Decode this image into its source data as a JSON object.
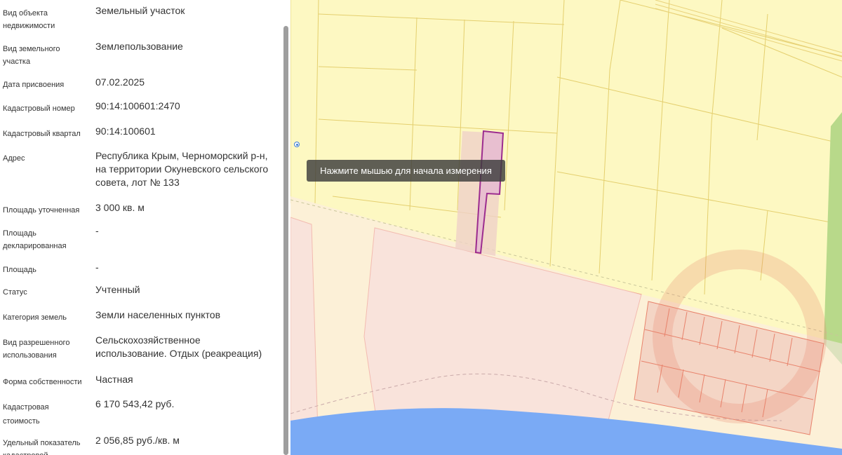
{
  "properties": [
    {
      "label": "Вид объекта\nнедвижимости",
      "value": "Земельный участок"
    },
    {
      "label": "Вид земельного\nучастка",
      "value": "Землепользование"
    },
    {
      "label": "Дата присвоения",
      "value": "07.02.2025"
    },
    {
      "label": "Кадастровый номер",
      "value": "90:14:100601:2470"
    },
    {
      "label": "Кадастровый квартал",
      "value": "90:14:100601"
    },
    {
      "label": "Адрес",
      "value": "Республика Крым, Черноморский р-н, на территории Окуневского сельского совета, лот № 133"
    },
    {
      "label": "Площадь уточненная",
      "value": "3 000 кв. м"
    },
    {
      "label": "Площадь\nдекларированная",
      "value": "-"
    },
    {
      "label": "Площадь",
      "value": "-"
    },
    {
      "label": "Статус",
      "value": "Учтенный"
    },
    {
      "label": "Категория земель",
      "value": "Земли населенных пунктов"
    },
    {
      "label": "Вид разрешенного\nиспользования",
      "value": "Сельскохозяйственное использование. Отдых (реакреация)"
    },
    {
      "label": "Форма собственности",
      "value": "Частная"
    },
    {
      "label": "Кадастровая\nстоимость",
      "value": "6 170 543,42 руб."
    },
    {
      "label": "Удельный показатель\nкадастровой",
      "value": "2 056,85 руб./кв. м"
    }
  ],
  "map": {
    "tooltip": "Нажмите мышью для начала измерения",
    "colors": {
      "land": "#fdf8c2",
      "parcel_line": "#e4cf6e",
      "zone_fill": "#f5dcca",
      "zone_line": "#e8836c",
      "selected_fill": "#e8bfd0",
      "selected_line": "#9c2c8f",
      "water": "#7aaaf5",
      "beach": "#fbeaea",
      "green_strip": "#b8d98a"
    }
  }
}
